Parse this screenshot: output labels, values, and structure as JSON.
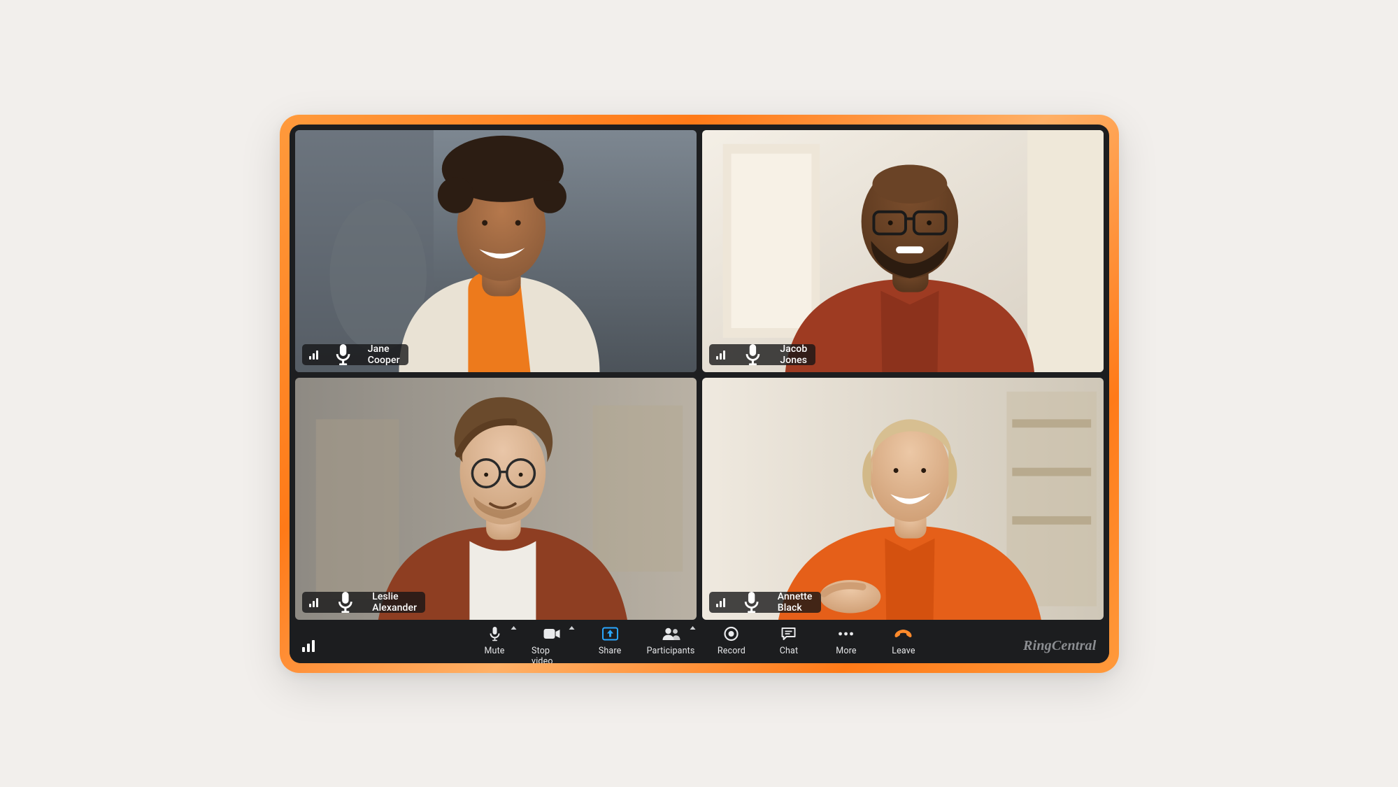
{
  "brand": "RingCentral",
  "participants": [
    {
      "name": "Jane Cooper"
    },
    {
      "name": "Jacob Jones"
    },
    {
      "name": "Leslie Alexander"
    },
    {
      "name": "Annette Black"
    }
  ],
  "toolbar": {
    "mute": {
      "label": "Mute",
      "icon": "microphone-icon",
      "has_caret": true
    },
    "stop_video": {
      "label": "Stop video",
      "icon": "video-camera-icon",
      "has_caret": true
    },
    "share": {
      "label": "Share",
      "icon": "share-screen-icon",
      "highlight": true
    },
    "participants": {
      "label": "Participants",
      "icon": "participants-icon",
      "has_caret": true
    },
    "record": {
      "label": "Record",
      "icon": "record-icon"
    },
    "chat": {
      "label": "Chat",
      "icon": "chat-icon"
    },
    "more": {
      "label": "More",
      "icon": "more-icon"
    },
    "leave": {
      "label": "Leave",
      "icon": "hangup-icon",
      "accent": "#ff8a2b"
    }
  },
  "colors": {
    "background": "#f2efec",
    "device_gradient": [
      "#ff9a3c",
      "#ff7a18",
      "#ffb066"
    ],
    "screen_bg": "#1d1e20",
    "toolbar_bg": "#1c1d1f",
    "highlight": "#2aa7ff",
    "leave_accent": "#ff8a2b"
  }
}
